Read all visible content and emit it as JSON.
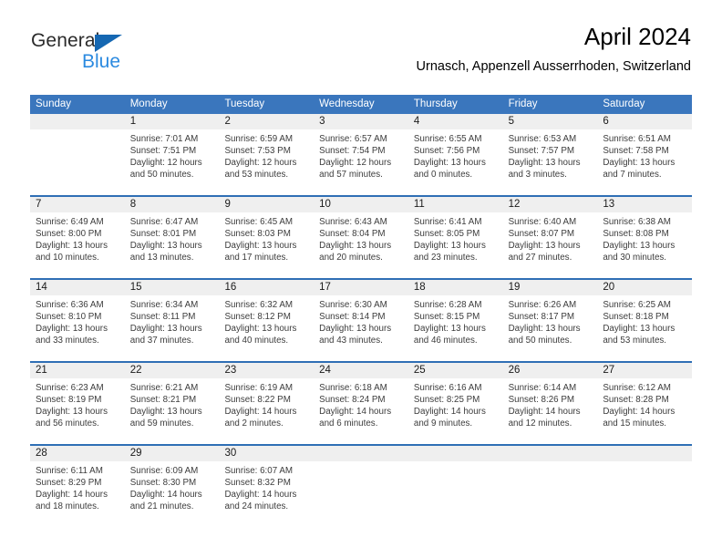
{
  "brand": {
    "name_part1": "General",
    "name_part2": "Blue",
    "triangle_icon": "triangle-icon",
    "accent_blue": "#1567b2",
    "light_blue": "#2b8ae0"
  },
  "header": {
    "title": "April 2024",
    "subtitle": "Urnasch, Appenzell Ausserrhoden, Switzerland"
  },
  "theme": {
    "header_bg": "#3a76bd",
    "header_text": "#ffffff",
    "row_separator": "#2f6fb5",
    "day_band_bg": "#efefef",
    "body_text": "#3c3c3c"
  },
  "calendar": {
    "weekdays": [
      "Sunday",
      "Monday",
      "Tuesday",
      "Wednesday",
      "Thursday",
      "Friday",
      "Saturday"
    ],
    "weeks": [
      [
        {
          "day": "",
          "sunrise": "",
          "sunset": "",
          "daylight": "",
          "daylight2": "",
          "empty": true
        },
        {
          "day": "1",
          "sunrise": "Sunrise: 7:01 AM",
          "sunset": "Sunset: 7:51 PM",
          "daylight": "Daylight: 12 hours",
          "daylight2": "and 50 minutes."
        },
        {
          "day": "2",
          "sunrise": "Sunrise: 6:59 AM",
          "sunset": "Sunset: 7:53 PM",
          "daylight": "Daylight: 12 hours",
          "daylight2": "and 53 minutes."
        },
        {
          "day": "3",
          "sunrise": "Sunrise: 6:57 AM",
          "sunset": "Sunset: 7:54 PM",
          "daylight": "Daylight: 12 hours",
          "daylight2": "and 57 minutes."
        },
        {
          "day": "4",
          "sunrise": "Sunrise: 6:55 AM",
          "sunset": "Sunset: 7:56 PM",
          "daylight": "Daylight: 13 hours",
          "daylight2": "and 0 minutes."
        },
        {
          "day": "5",
          "sunrise": "Sunrise: 6:53 AM",
          "sunset": "Sunset: 7:57 PM",
          "daylight": "Daylight: 13 hours",
          "daylight2": "and 3 minutes."
        },
        {
          "day": "6",
          "sunrise": "Sunrise: 6:51 AM",
          "sunset": "Sunset: 7:58 PM",
          "daylight": "Daylight: 13 hours",
          "daylight2": "and 7 minutes."
        }
      ],
      [
        {
          "day": "7",
          "sunrise": "Sunrise: 6:49 AM",
          "sunset": "Sunset: 8:00 PM",
          "daylight": "Daylight: 13 hours",
          "daylight2": "and 10 minutes."
        },
        {
          "day": "8",
          "sunrise": "Sunrise: 6:47 AM",
          "sunset": "Sunset: 8:01 PM",
          "daylight": "Daylight: 13 hours",
          "daylight2": "and 13 minutes."
        },
        {
          "day": "9",
          "sunrise": "Sunrise: 6:45 AM",
          "sunset": "Sunset: 8:03 PM",
          "daylight": "Daylight: 13 hours",
          "daylight2": "and 17 minutes."
        },
        {
          "day": "10",
          "sunrise": "Sunrise: 6:43 AM",
          "sunset": "Sunset: 8:04 PM",
          "daylight": "Daylight: 13 hours",
          "daylight2": "and 20 minutes."
        },
        {
          "day": "11",
          "sunrise": "Sunrise: 6:41 AM",
          "sunset": "Sunset: 8:05 PM",
          "daylight": "Daylight: 13 hours",
          "daylight2": "and 23 minutes."
        },
        {
          "day": "12",
          "sunrise": "Sunrise: 6:40 AM",
          "sunset": "Sunset: 8:07 PM",
          "daylight": "Daylight: 13 hours",
          "daylight2": "and 27 minutes."
        },
        {
          "day": "13",
          "sunrise": "Sunrise: 6:38 AM",
          "sunset": "Sunset: 8:08 PM",
          "daylight": "Daylight: 13 hours",
          "daylight2": "and 30 minutes."
        }
      ],
      [
        {
          "day": "14",
          "sunrise": "Sunrise: 6:36 AM",
          "sunset": "Sunset: 8:10 PM",
          "daylight": "Daylight: 13 hours",
          "daylight2": "and 33 minutes."
        },
        {
          "day": "15",
          "sunrise": "Sunrise: 6:34 AM",
          "sunset": "Sunset: 8:11 PM",
          "daylight": "Daylight: 13 hours",
          "daylight2": "and 37 minutes."
        },
        {
          "day": "16",
          "sunrise": "Sunrise: 6:32 AM",
          "sunset": "Sunset: 8:12 PM",
          "daylight": "Daylight: 13 hours",
          "daylight2": "and 40 minutes."
        },
        {
          "day": "17",
          "sunrise": "Sunrise: 6:30 AM",
          "sunset": "Sunset: 8:14 PM",
          "daylight": "Daylight: 13 hours",
          "daylight2": "and 43 minutes."
        },
        {
          "day": "18",
          "sunrise": "Sunrise: 6:28 AM",
          "sunset": "Sunset: 8:15 PM",
          "daylight": "Daylight: 13 hours",
          "daylight2": "and 46 minutes."
        },
        {
          "day": "19",
          "sunrise": "Sunrise: 6:26 AM",
          "sunset": "Sunset: 8:17 PM",
          "daylight": "Daylight: 13 hours",
          "daylight2": "and 50 minutes."
        },
        {
          "day": "20",
          "sunrise": "Sunrise: 6:25 AM",
          "sunset": "Sunset: 8:18 PM",
          "daylight": "Daylight: 13 hours",
          "daylight2": "and 53 minutes."
        }
      ],
      [
        {
          "day": "21",
          "sunrise": "Sunrise: 6:23 AM",
          "sunset": "Sunset: 8:19 PM",
          "daylight": "Daylight: 13 hours",
          "daylight2": "and 56 minutes."
        },
        {
          "day": "22",
          "sunrise": "Sunrise: 6:21 AM",
          "sunset": "Sunset: 8:21 PM",
          "daylight": "Daylight: 13 hours",
          "daylight2": "and 59 minutes."
        },
        {
          "day": "23",
          "sunrise": "Sunrise: 6:19 AM",
          "sunset": "Sunset: 8:22 PM",
          "daylight": "Daylight: 14 hours",
          "daylight2": "and 2 minutes."
        },
        {
          "day": "24",
          "sunrise": "Sunrise: 6:18 AM",
          "sunset": "Sunset: 8:24 PM",
          "daylight": "Daylight: 14 hours",
          "daylight2": "and 6 minutes."
        },
        {
          "day": "25",
          "sunrise": "Sunrise: 6:16 AM",
          "sunset": "Sunset: 8:25 PM",
          "daylight": "Daylight: 14 hours",
          "daylight2": "and 9 minutes."
        },
        {
          "day": "26",
          "sunrise": "Sunrise: 6:14 AM",
          "sunset": "Sunset: 8:26 PM",
          "daylight": "Daylight: 14 hours",
          "daylight2": "and 12 minutes."
        },
        {
          "day": "27",
          "sunrise": "Sunrise: 6:12 AM",
          "sunset": "Sunset: 8:28 PM",
          "daylight": "Daylight: 14 hours",
          "daylight2": "and 15 minutes."
        }
      ],
      [
        {
          "day": "28",
          "sunrise": "Sunrise: 6:11 AM",
          "sunset": "Sunset: 8:29 PM",
          "daylight": "Daylight: 14 hours",
          "daylight2": "and 18 minutes."
        },
        {
          "day": "29",
          "sunrise": "Sunrise: 6:09 AM",
          "sunset": "Sunset: 8:30 PM",
          "daylight": "Daylight: 14 hours",
          "daylight2": "and 21 minutes."
        },
        {
          "day": "30",
          "sunrise": "Sunrise: 6:07 AM",
          "sunset": "Sunset: 8:32 PM",
          "daylight": "Daylight: 14 hours",
          "daylight2": "and 24 minutes."
        },
        {
          "day": "",
          "sunrise": "",
          "sunset": "",
          "daylight": "",
          "daylight2": "",
          "empty": true
        },
        {
          "day": "",
          "sunrise": "",
          "sunset": "",
          "daylight": "",
          "daylight2": "",
          "empty": true
        },
        {
          "day": "",
          "sunrise": "",
          "sunset": "",
          "daylight": "",
          "daylight2": "",
          "empty": true
        },
        {
          "day": "",
          "sunrise": "",
          "sunset": "",
          "daylight": "",
          "daylight2": "",
          "empty": true
        }
      ]
    ]
  }
}
